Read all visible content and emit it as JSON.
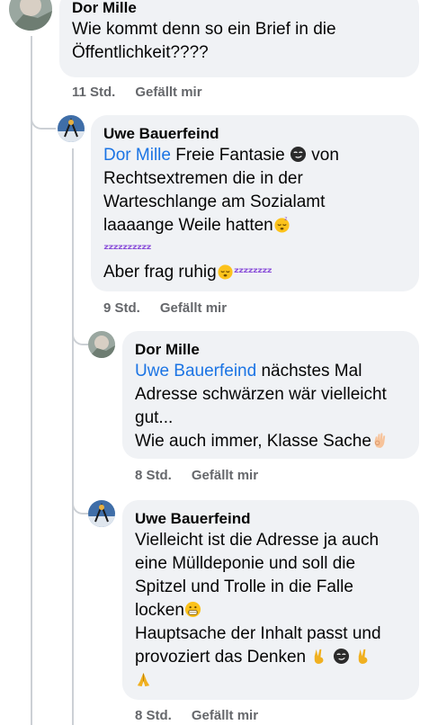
{
  "comments": [
    {
      "author": "Dor Mille",
      "text_line1": "Wie kommt denn so ein Brief in die",
      "text_line2": "Öffentlichkeit????",
      "time": "11 Std.",
      "like": "Gefällt mir"
    },
    {
      "author": "Uwe Bauerfeind",
      "mention": "Dor Mille",
      "t1": "Freie Fantasie",
      "t2": "von",
      "line2": "Rechtsextremen die in der",
      "line3": "Warteschlange am Sozialamt",
      "line4": "laaaange Weile hatten",
      "zzz": "ᶻᶻᶻᶻᶻᶻᶻᶻᶻᶻ",
      "line6": "Aber frag ruhig",
      "zzz2": "ᶻᶻᶻᶻᶻᶻᶻᶻ",
      "time": "9 Std.",
      "like": "Gefällt mir"
    },
    {
      "author": "Dor Mille",
      "mention": "Uwe Bauerfeind",
      "t1": "nächstes Mal",
      "line2": "Adresse schwärzen wär vielleicht",
      "line3": "gut...",
      "line4": "Wie auch immer, Klasse Sache",
      "time": "8 Std.",
      "like": "Gefällt mir"
    },
    {
      "author": "Uwe Bauerfeind",
      "line1": "Vielleicht ist die Adresse ja auch",
      "line2": "eine Mülldeponie und soll die",
      "line3": "Spitzel und Trolle in die Falle",
      "line4": "locken",
      "line5": "Hauptsache der Inhalt passt und",
      "line6": "provoziert das Denken",
      "time": "8 Std.",
      "like": "Gefällt mir"
    }
  ],
  "colors": {
    "bubble": "#f0f2f5",
    "mention": "#1b74e4",
    "meta": "#65676b",
    "thread": "#ccd0d5"
  },
  "icons": [
    "sleeping-face-emoji",
    "smirk-face-emoji",
    "ok-hand-emoji",
    "grimacing-face-emoji",
    "victory-hand-emoji",
    "folded-hands-emoji",
    "profile-avatar"
  ]
}
